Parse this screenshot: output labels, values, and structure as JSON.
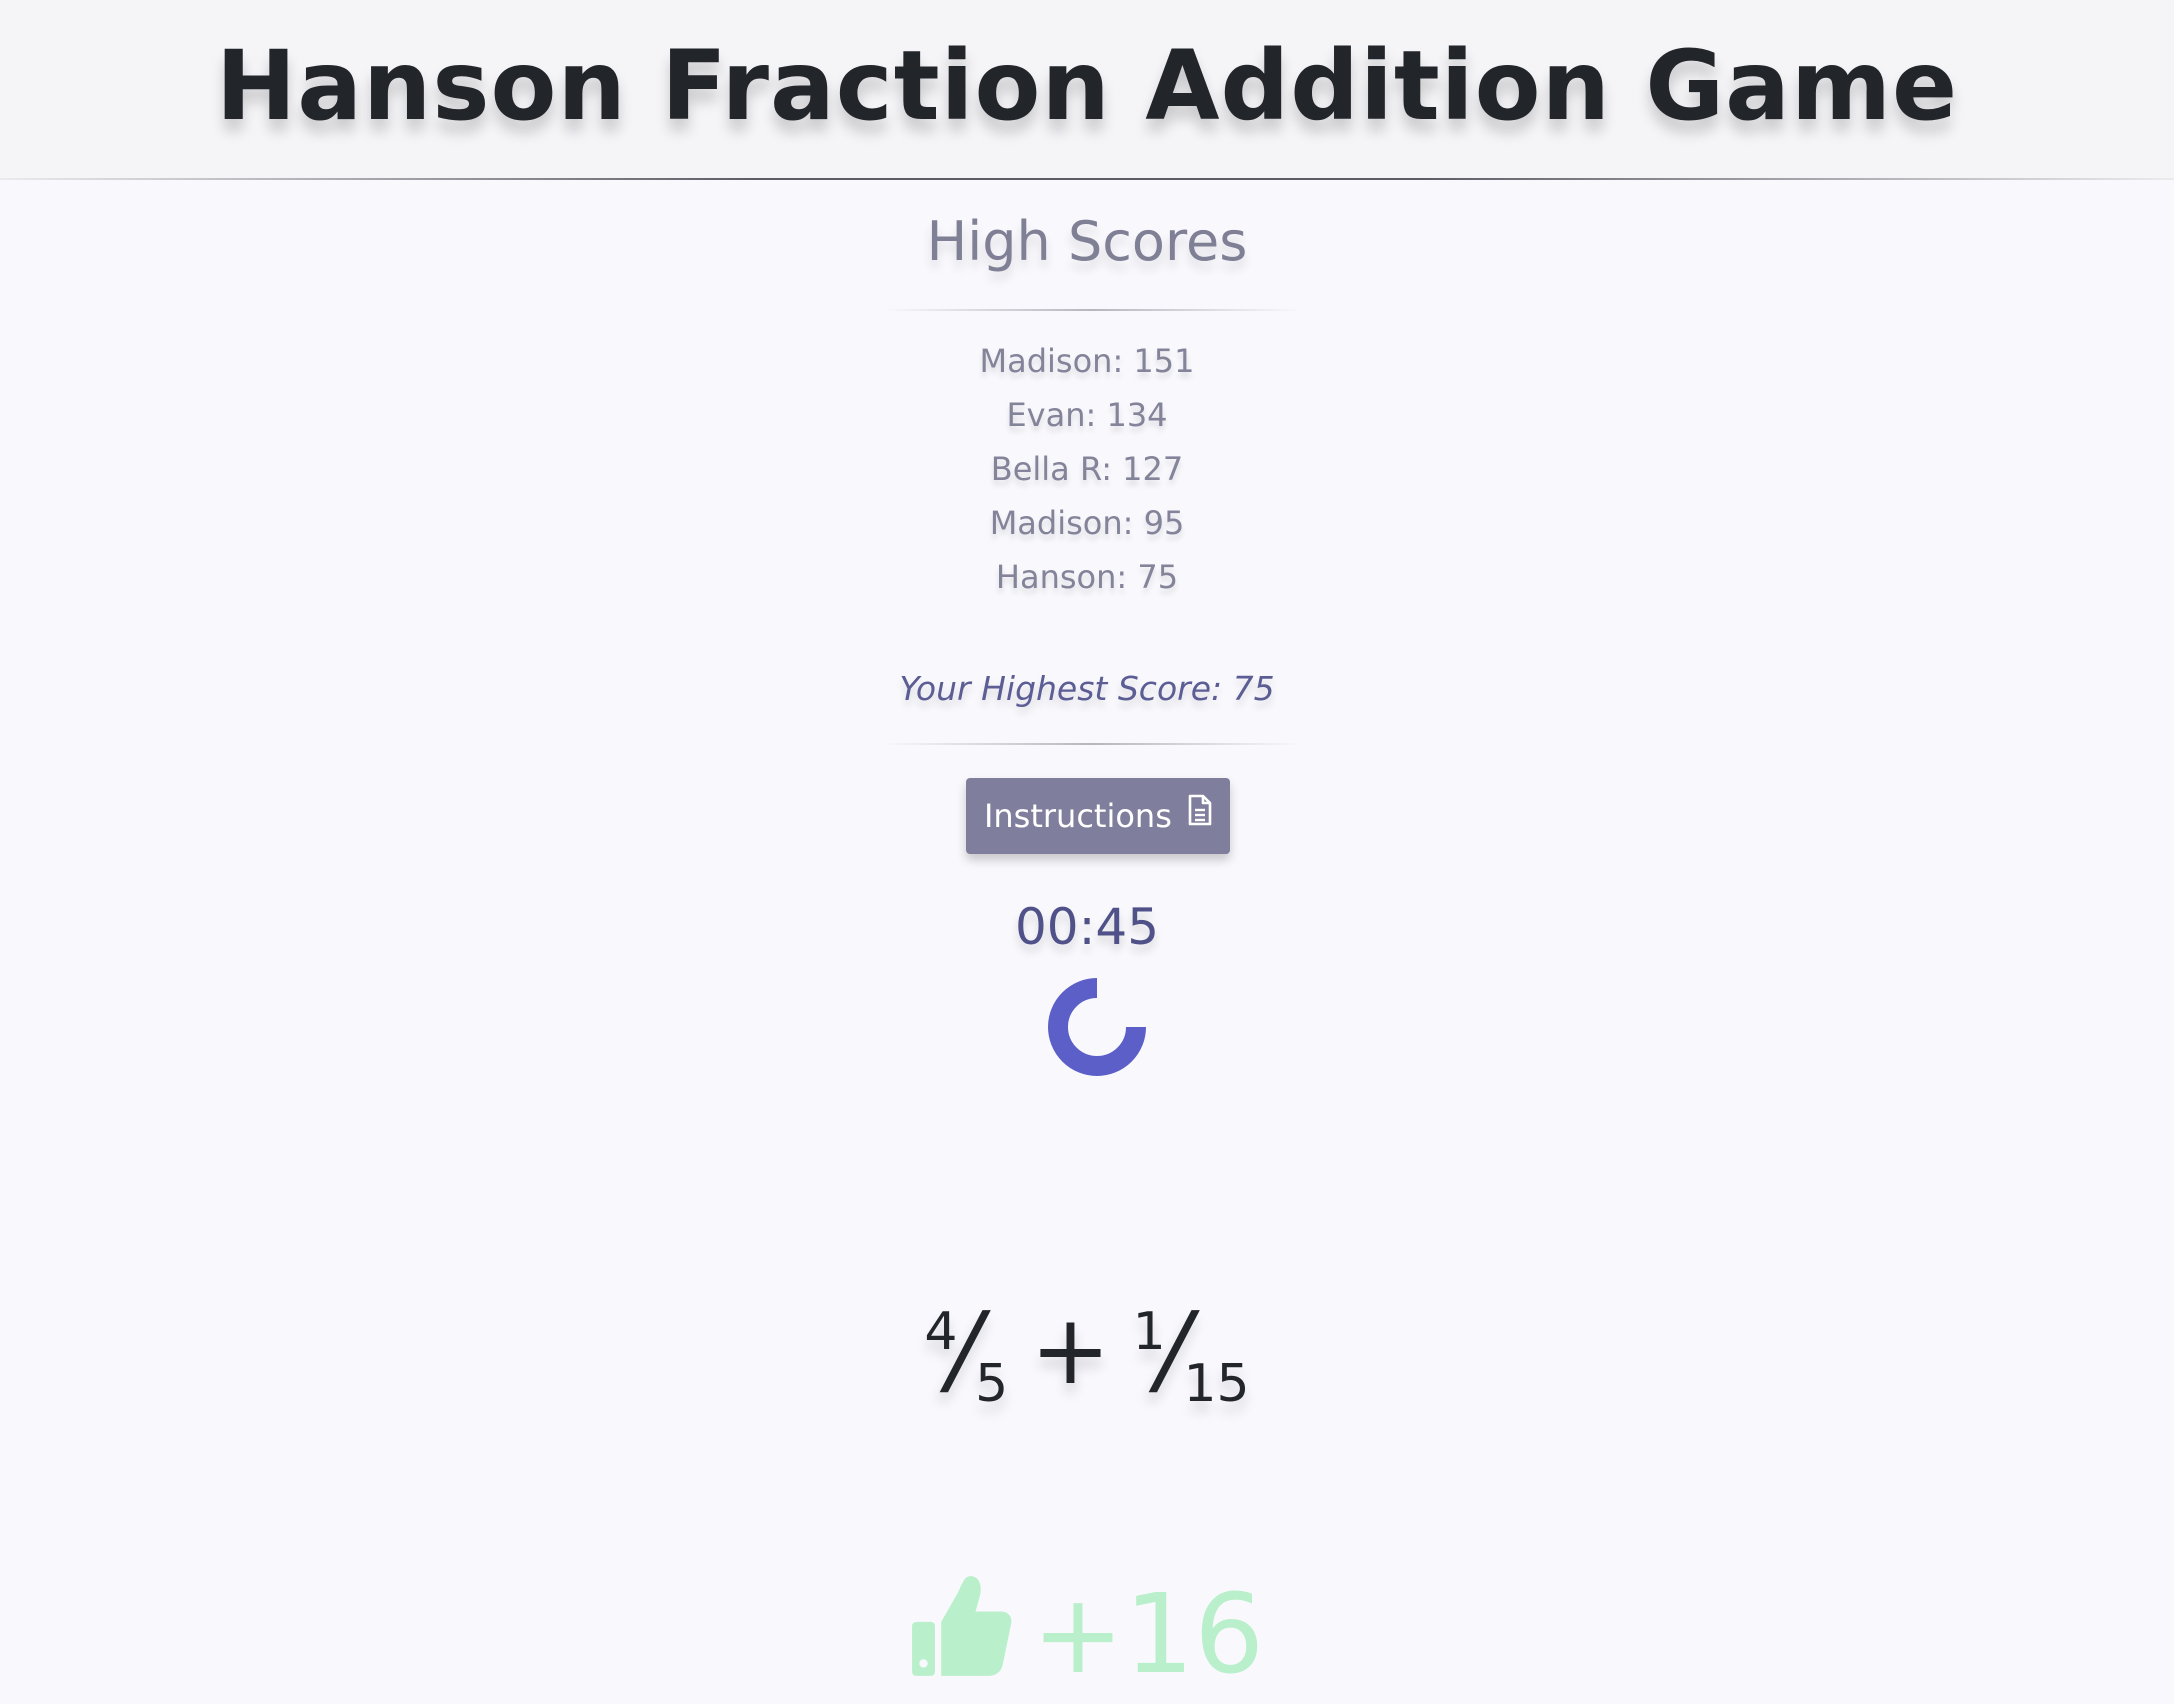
{
  "header": {
    "title": "Hanson Fraction Addition Game"
  },
  "high_scores": {
    "title": "High Scores",
    "entries": [
      "Madison: 151",
      "Evan: 134",
      "Bella R: 127",
      "Madison: 95",
      "Hanson: 75"
    ],
    "your_highest": "Your Highest Score: 75"
  },
  "controls": {
    "instructions_label": "Instructions",
    "instructions_icon": "document-icon"
  },
  "timer": {
    "display": "00:45",
    "spinner_icon": "loading-spinner-icon"
  },
  "problem": {
    "a_num": "4",
    "a_den": "5",
    "operator": "+",
    "b_num": "1",
    "b_den": "15"
  },
  "feedback": {
    "icon": "thumbs-up-icon",
    "points": "+16"
  },
  "colors": {
    "background": "#f9f9fd",
    "title": "#22252a",
    "muted": "#83839a",
    "accent": "#5b5fc7",
    "button": "#7f7f9d",
    "success": "#b9f0cb"
  }
}
